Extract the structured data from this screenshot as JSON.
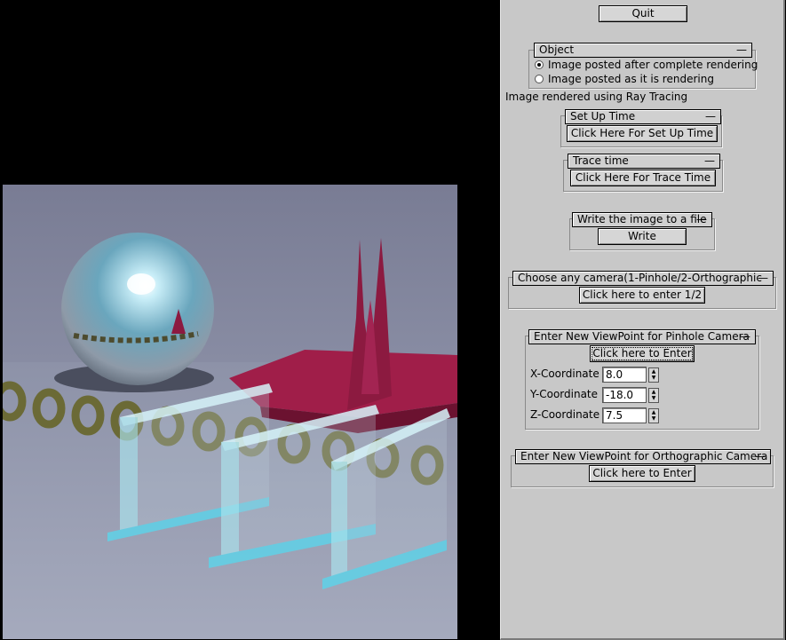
{
  "panel": {
    "quit_label": "Quit",
    "object_group": {
      "title": "Object",
      "collapse": "—",
      "options": [
        {
          "label": "Image posted after complete rendering",
          "selected": true
        },
        {
          "label": "Image posted as it is rendering",
          "selected": false
        }
      ]
    },
    "render_status": "Image rendered using Ray Tracing",
    "setup_time": {
      "title": "Set Up Time",
      "collapse": "—",
      "button": "Click Here For Set Up Time"
    },
    "trace_time": {
      "title": "Trace time",
      "collapse": "—",
      "button": "Click Here For Trace Time"
    },
    "write_file": {
      "title": "Write the image to a file",
      "collapse": "—",
      "button": "Write"
    },
    "camera_choice": {
      "title": "Choose any camera(1-Pinhole/2-Orthographic",
      "collapse": "—",
      "button": "Click here to enter 1/2"
    },
    "pinhole": {
      "title": "Enter New ViewPoint for Pinhole Camera",
      "collapse": "—",
      "button": "Click here to Enter",
      "fields": [
        {
          "label": "X-Coordinate",
          "value": "8.0"
        },
        {
          "label": "Y-Coordinate",
          "value": "-18.0"
        },
        {
          "label": "Z-Coordinate",
          "value": "7.5"
        }
      ]
    },
    "orthographic": {
      "title": "Enter New ViewPoint for Orthographic Camera",
      "collapse": "—",
      "button": "Click here to Enter"
    }
  },
  "scene": {
    "colors": {
      "floor": "#9aa0b4",
      "backdrop": "#7c8098",
      "sphere": "#8fc2d6",
      "surface": "#9b1b45",
      "ring": "#6b6a36",
      "glass": "#a8e6f0"
    }
  }
}
